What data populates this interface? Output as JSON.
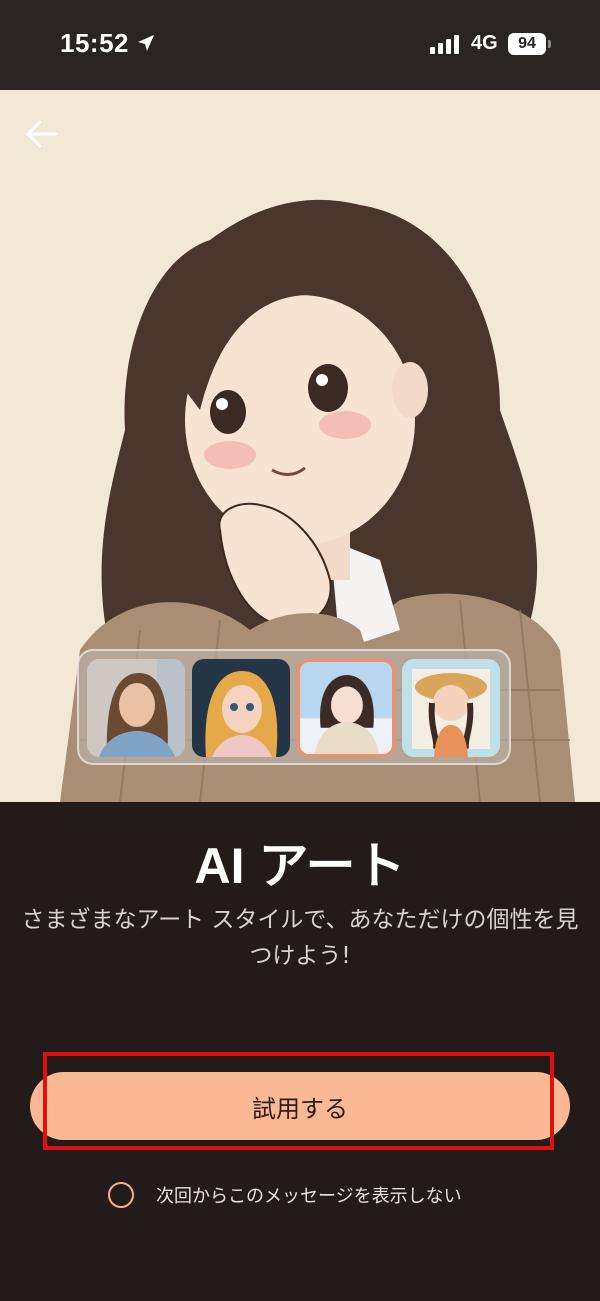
{
  "status_bar": {
    "time": "15:52",
    "network": "4G",
    "battery": "94",
    "icons": [
      "location-arrow-icon",
      "signal-bars-icon",
      "battery-icon"
    ]
  },
  "hero": {
    "back_icon": "back-arrow-icon",
    "thumbnails": [
      {
        "name": "realistic-portrait"
      },
      {
        "name": "fairytale-portrait"
      },
      {
        "name": "winter-anime-portrait",
        "selected": true
      },
      {
        "name": "chibi-straw-hat-portrait"
      }
    ]
  },
  "content": {
    "title": "AI アート",
    "description": "さまざまなアート スタイルで、あなただけの個性を見つけよう!",
    "try_button": "試用する",
    "dont_show_label": "次回からこのメッセージを表示しない"
  },
  "colors": {
    "background": "#231b1a",
    "accent": "#fbb895",
    "highlight": "#e30f0f",
    "radio": "#f4b08e"
  }
}
